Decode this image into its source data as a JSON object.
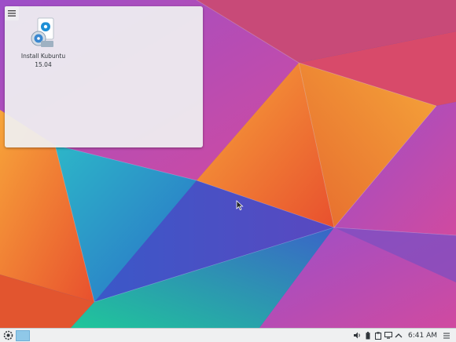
{
  "desktop": {
    "icons": [
      {
        "name_line1": "Install Kubuntu",
        "name_line2": "15.04"
      }
    ]
  },
  "taskbar": {
    "clock": "6:41 AM"
  },
  "colors": {
    "panel_bg": "#eff0f1",
    "pager_active": "#8fc8e8",
    "text": "#31363b"
  },
  "icons": [
    "desktop-toolbox-icon",
    "kubuntu-installer-icon",
    "kde-launcher-icon",
    "volume-icon",
    "battery-icon",
    "clipboard-icon",
    "network-icon",
    "expand-tray-icon",
    "panel-menu-icon",
    "mouse-cursor-icon"
  ]
}
